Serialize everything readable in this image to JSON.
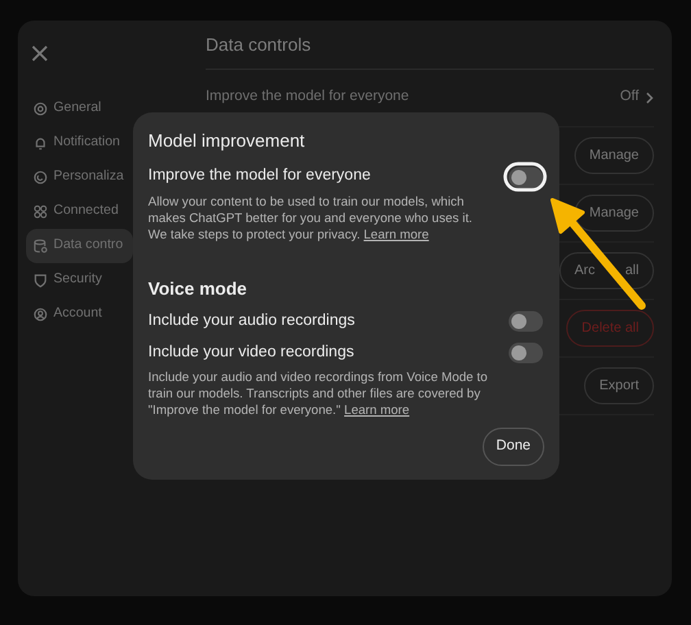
{
  "sidebar": {
    "items": [
      {
        "label": "General",
        "selected": false
      },
      {
        "label": "Notification",
        "selected": false
      },
      {
        "label": "Personaliza",
        "selected": false
      },
      {
        "label": "Connected",
        "selected": false
      },
      {
        "label": "Data contro",
        "selected": true
      },
      {
        "label": "Security",
        "selected": false
      },
      {
        "label": "Account",
        "selected": false
      }
    ]
  },
  "main": {
    "title": "Data controls",
    "rows": [
      {
        "kind": "setting",
        "label": "Improve the model for everyone",
        "value": "Off"
      },
      {
        "kind": "button",
        "button": "Manage"
      },
      {
        "kind": "button",
        "button": "Manage"
      },
      {
        "kind": "button",
        "button_parts": [
          "Arc",
          "all"
        ]
      },
      {
        "kind": "danger",
        "button": "Delete all"
      },
      {
        "kind": "button",
        "button": "Export"
      }
    ]
  },
  "dialog": {
    "title": "Model improvement",
    "items": [
      {
        "kind": "toggle",
        "label": "Improve the model for everyone",
        "on": false
      },
      {
        "kind": "description",
        "text": "Allow your content to be used to train our models, which makes ChatGPT better for you and everyone who uses it. We take steps to protect your privacy.",
        "link": "Learn more"
      },
      {
        "kind": "heading",
        "text": "Voice mode"
      },
      {
        "kind": "toggle",
        "label": "Include your audio recordings",
        "on": false
      },
      {
        "kind": "toggle",
        "label": "Include your video recordings",
        "on": false
      },
      {
        "kind": "description",
        "text": "Include your audio and video recordings from Voice Mode to train our models. Transcripts and other files are covered by \"Improve the model for everyone.\"",
        "link": "Learn more"
      }
    ],
    "button": "Done"
  }
}
